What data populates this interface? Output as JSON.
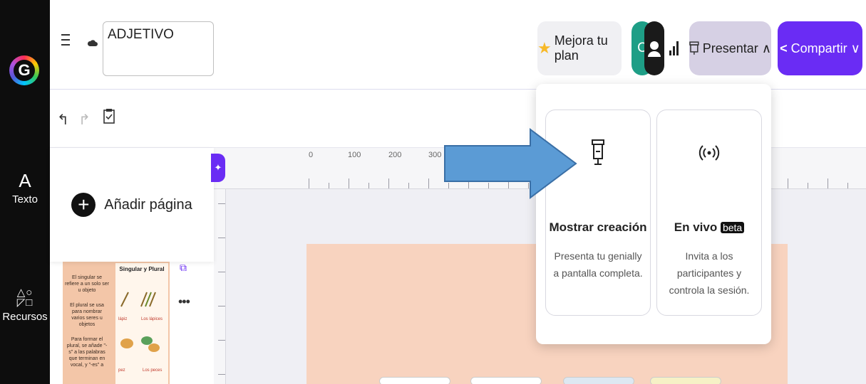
{
  "header": {
    "doc_title": "ADJETIVO",
    "upgrade_label": "Mejora tu plan",
    "avatar_initial": "C",
    "present_label": "Presentar",
    "share_label": "Compartir"
  },
  "sidebar": {
    "items": [
      {
        "label": "Texto",
        "icon": "text-icon"
      },
      {
        "label": "Recursos",
        "icon": "shapes-icon"
      }
    ]
  },
  "pages_panel": {
    "add_page_label": "Añadir página"
  },
  "thumbnail": {
    "heading": "Singular y Plural",
    "lines": [
      "El singular se refiere a un solo ser u objeto",
      "El plural se usa para nombrar varios seres u objetos",
      "Para formar el plural, se añade \"-s\" a las palabras que terminan en vocal, y \"-es\" a"
    ],
    "words": [
      "lápiz",
      "Los lápices",
      "pez",
      "Los peces"
    ]
  },
  "ruler": {
    "labels": [
      "0",
      "100",
      "200",
      "300"
    ]
  },
  "present_menu": {
    "options": [
      {
        "title": "Mostrar creación",
        "description": "Presenta tu genially a pantalla completa.",
        "icon": "projector-icon"
      },
      {
        "title": "En vivo",
        "badge": "beta",
        "description": "Invita a los participantes y controla la sesión.",
        "icon": "broadcast-icon"
      }
    ]
  },
  "colors": {
    "accent": "#6a2cf4",
    "canvas_bg": "#f8d3bf",
    "arrow": "#5b9bd5"
  }
}
